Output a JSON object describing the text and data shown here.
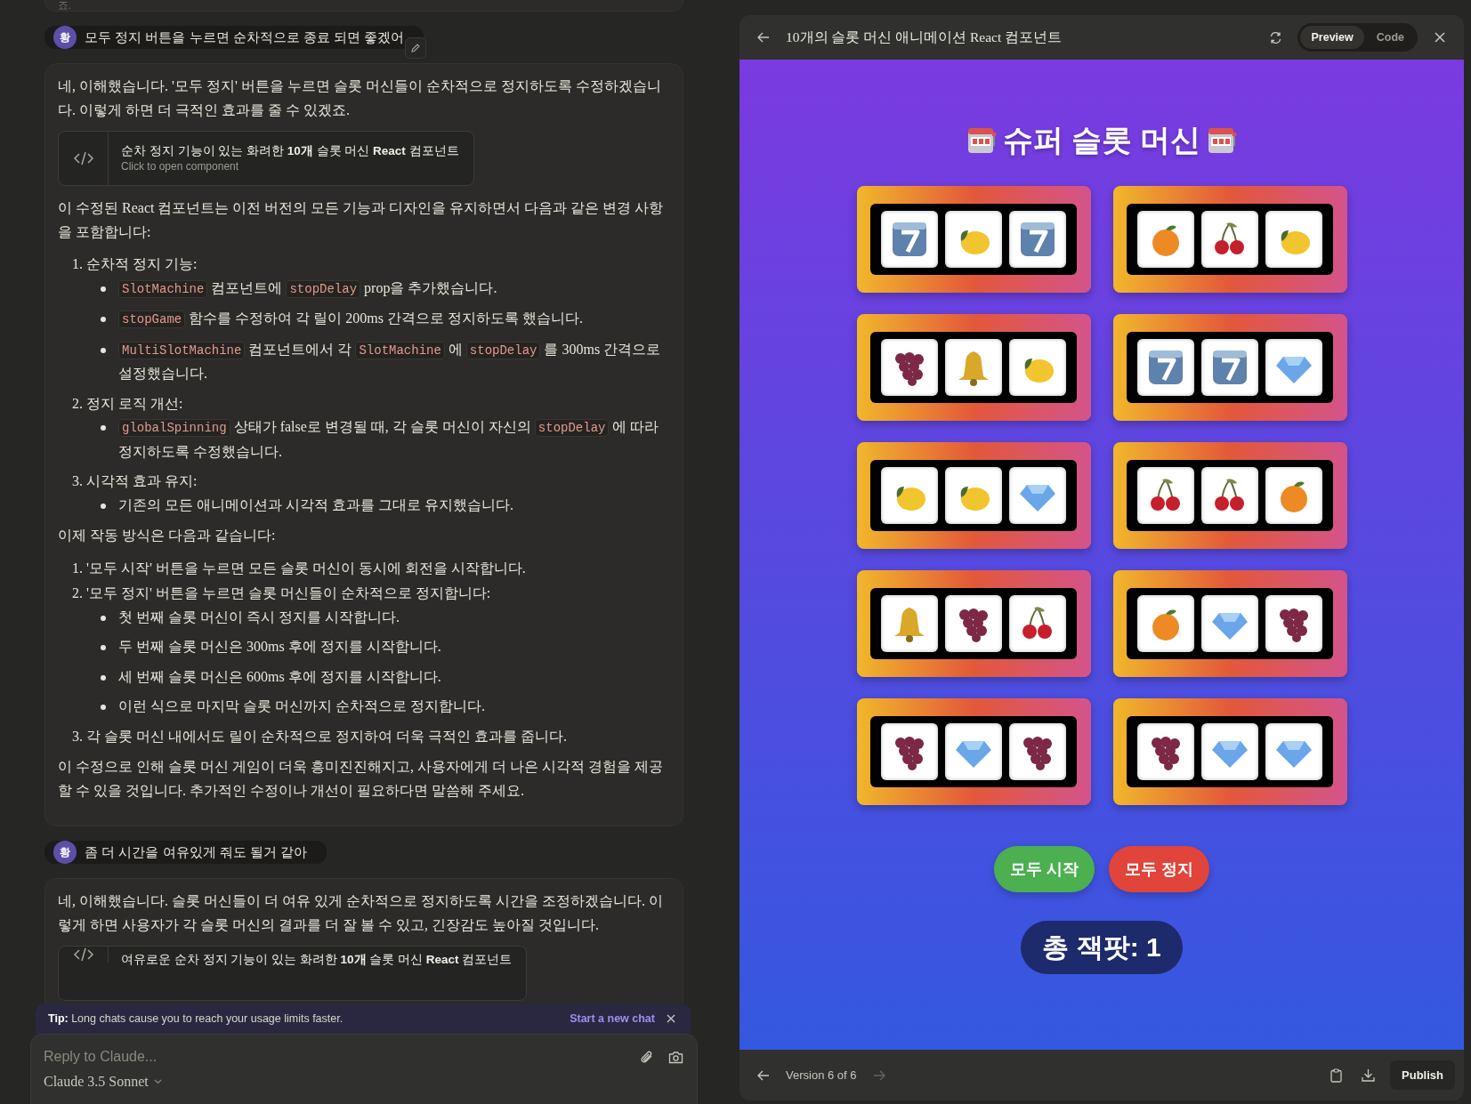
{
  "chat": {
    "previous_tail": "죠.",
    "messages": [
      {
        "kind": "user",
        "avatar": "황",
        "text": "모두 정지 버튼을 누르면 순차적으로 종료 되면 좋겠어",
        "editable": true
      },
      {
        "kind": "assistant",
        "blocks": [
          {
            "kind": "paragraph",
            "text": "네, 이해했습니다. '모두 정지' 버튼을 누르면 슬롯 머신들이 순차적으로 정지하도록 수정하겠습니다. 이렇게 하면 더 극적인 효과를 줄 수 있겠죠."
          },
          {
            "kind": "artifact",
            "title": "순차 정지 기능이 있는 화려한 **10개** 슬롯 머신 **React** 컴포넌트",
            "subtitle": "Click to open component"
          },
          {
            "kind": "paragraph",
            "text": "이 수정된 React 컴포넌트는 이전 버전의 모든 기능과 디자인을 유지하면서 다음과 같은 변경 사항을 포함합니다:"
          },
          {
            "kind": "list",
            "items": [
              {
                "number": "1.",
                "text": "순차적 정지 기능:",
                "children": [
                  {
                    "segments": [
                      {
                        "kind": "code",
                        "text": "SlotMachine"
                      },
                      {
                        "kind": "text",
                        "text": " 컴포넌트에 "
                      },
                      {
                        "kind": "code",
                        "text": "stopDelay"
                      },
                      {
                        "kind": "text",
                        "text": " prop을 추가했습니다."
                      }
                    ]
                  },
                  {
                    "segments": [
                      {
                        "kind": "code",
                        "text": "stopGame"
                      },
                      {
                        "kind": "text",
                        "text": " 함수를 수정하여 각 릴이 200ms 간격으로 정지하도록 했습니다."
                      }
                    ]
                  },
                  {
                    "segments": [
                      {
                        "kind": "code",
                        "text": "MultiSlotMachine"
                      },
                      {
                        "kind": "text",
                        "text": " 컴포넌트에서 각 "
                      },
                      {
                        "kind": "code",
                        "text": "SlotMachine"
                      },
                      {
                        "kind": "text",
                        "text": " 에 "
                      },
                      {
                        "kind": "code",
                        "text": "stopDelay"
                      },
                      {
                        "kind": "text",
                        "text": " 를 300ms 간격으로 설정했습니다."
                      }
                    ]
                  }
                ]
              },
              {
                "number": "2.",
                "text": "정지 로직 개선:",
                "children": [
                  {
                    "segments": [
                      {
                        "kind": "code",
                        "text": "globalSpinning"
                      },
                      {
                        "kind": "text",
                        "text": " 상태가 false로 변경될 때, 각 슬롯 머신이 자신의 "
                      },
                      {
                        "kind": "code",
                        "text": "stopDelay"
                      },
                      {
                        "kind": "text",
                        "text": " 에 따라 정지하도록 수정했습니다."
                      }
                    ]
                  }
                ]
              },
              {
                "number": "3.",
                "text": "시각적 효과 유지:",
                "children": [
                  {
                    "segments": [
                      {
                        "kind": "text",
                        "text": "기존의 모든 애니메이션과 시각적 효과를 그대로 유지했습니다."
                      }
                    ]
                  }
                ]
              }
            ]
          },
          {
            "kind": "paragraph",
            "text": "이제 작동 방식은 다음과 같습니다:"
          },
          {
            "kind": "list",
            "items": [
              {
                "number": "1.",
                "text": "'모두 시작' 버튼을 누르면 모든 슬롯 머신이 동시에 회전을 시작합니다."
              },
              {
                "number": "2.",
                "text": "'모두 정지' 버튼을 누르면 슬롯 머신들이 순차적으로 정지합니다:",
                "children": [
                  {
                    "segments": [
                      {
                        "kind": "text",
                        "text": "첫 번째 슬롯 머신이 즉시 정지를 시작합니다."
                      }
                    ]
                  },
                  {
                    "segments": [
                      {
                        "kind": "text",
                        "text": "두 번째 슬롯 머신은 300ms 후에 정지를 시작합니다."
                      }
                    ]
                  },
                  {
                    "segments": [
                      {
                        "kind": "text",
                        "text": "세 번째 슬롯 머신은 600ms 후에 정지를 시작합니다."
                      }
                    ]
                  },
                  {
                    "segments": [
                      {
                        "kind": "text",
                        "text": "이런 식으로 마지막 슬롯 머신까지 순차적으로 정지합니다."
                      }
                    ]
                  }
                ]
              },
              {
                "number": "3.",
                "text": "각 슬롯 머신 내에서도 릴이 순차적으로 정지하여 더욱 극적인 효과를 줍니다."
              }
            ]
          },
          {
            "kind": "paragraph",
            "text": "이 수정으로 인해 슬롯 머신 게임이 더욱 흥미진진해지고, 사용자에게 더 나은 시각적 경험을 제공할 수 있을 것입니다. 추가적인 수정이나 개선이 필요하다면 말씀해 주세요."
          }
        ]
      },
      {
        "kind": "user",
        "avatar": "황",
        "text": "좀 더 시간을 여유있게 줘도 될거 같아",
        "editable": false
      },
      {
        "kind": "assistant",
        "blocks": [
          {
            "kind": "paragraph",
            "text": "네, 이해했습니다. 슬롯 머신들이 더 여유 있게 순차적으로 정지하도록 시간을 조정하겠습니다. 이렇게 하면 사용자가 각 슬롯 머신의 결과를 더 잘 볼 수 있고, 긴장감도 높아질 것입니다."
          },
          {
            "kind": "artifact",
            "title": "여유로운 순차 정지 기능이 있는 화려한 **10개** 슬롯 머신 **React** 컴포넌트"
          }
        ]
      }
    ],
    "tip": {
      "text": "**Tip:** Long chats cause you to reach your usage limits faster.",
      "link": "Start a new chat"
    },
    "composer": {
      "placeholder": "Reply to Claude...",
      "model": "Claude 3.5 Sonnet"
    }
  },
  "artifact": {
    "title": "10개의 슬롯 머신 애니메이션 React 컴포넌트",
    "tabs": [
      {
        "label": "Preview",
        "selected": true
      },
      {
        "label": "Code",
        "selected": false
      }
    ],
    "preview": {
      "title": "슈퍼 슬롯 머신",
      "machines": [
        {
          "reels": [
            {
              "kind": "seven"
            },
            {
              "kind": "lemon"
            },
            {
              "kind": "seven"
            }
          ]
        },
        {
          "reels": [
            {
              "kind": "orange"
            },
            {
              "kind": "cherry"
            },
            {
              "kind": "lemon"
            }
          ]
        },
        {
          "reels": [
            {
              "kind": "grape"
            },
            {
              "kind": "bell"
            },
            {
              "kind": "lemon"
            }
          ]
        },
        {
          "reels": [
            {
              "kind": "seven"
            },
            {
              "kind": "seven"
            },
            {
              "kind": "diamond"
            }
          ]
        },
        {
          "reels": [
            {
              "kind": "lemon"
            },
            {
              "kind": "lemon"
            },
            {
              "kind": "diamond"
            }
          ]
        },
        {
          "reels": [
            {
              "kind": "cherry"
            },
            {
              "kind": "cherry"
            },
            {
              "kind": "orange"
            }
          ]
        },
        {
          "reels": [
            {
              "kind": "bell"
            },
            {
              "kind": "grape"
            },
            {
              "kind": "cherry"
            }
          ]
        },
        {
          "reels": [
            {
              "kind": "orange"
            },
            {
              "kind": "diamond"
            },
            {
              "kind": "grape"
            }
          ]
        },
        {
          "reels": [
            {
              "kind": "grape"
            },
            {
              "kind": "diamond"
            },
            {
              "kind": "grape"
            }
          ]
        },
        {
          "reels": [
            {
              "kind": "grape"
            },
            {
              "kind": "diamond"
            },
            {
              "kind": "diamond"
            }
          ]
        }
      ],
      "buttons": [
        {
          "kind": "start",
          "label": "모두 시작"
        },
        {
          "kind": "stop",
          "label": "모두 정지"
        }
      ],
      "jackpot": "총 잭팟: 1"
    },
    "footer": {
      "version": "Version 6 of 6",
      "next_disabled": true,
      "publish": "Publish"
    }
  }
}
